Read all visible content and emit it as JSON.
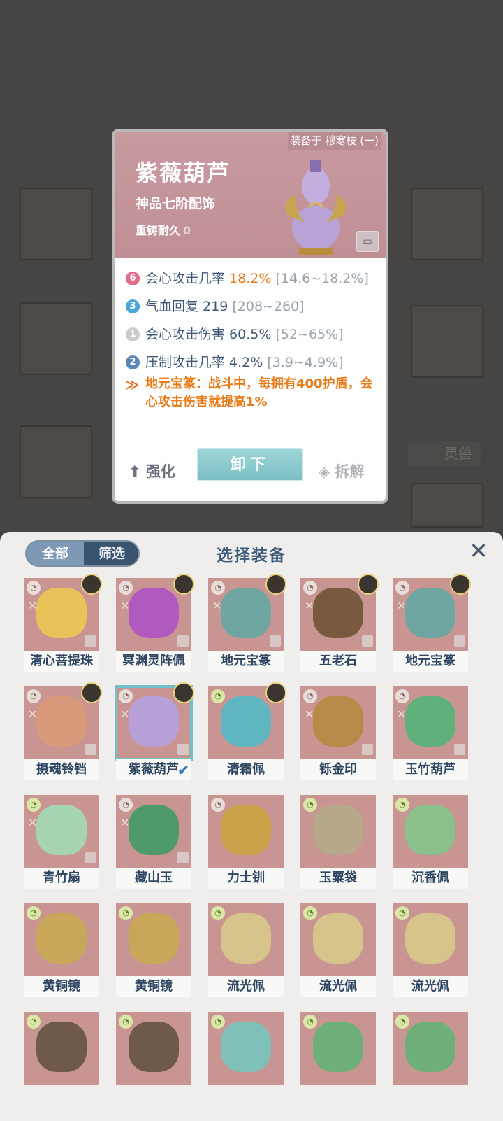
{
  "popup": {
    "equipped_to": "装备于 穆寒枝 (一)",
    "name": "紫薇葫芦",
    "grade": "神品七阶配饰",
    "recast_label": "重铸耐久",
    "recast_value": "0",
    "stats": [
      {
        "badge": "6",
        "badge_color": "#e56a8c",
        "label": "会心攻击几率 ",
        "value": "18.2%",
        "highlight": true,
        "range": " [14.6~18.2%]"
      },
      {
        "badge": "3",
        "badge_color": "#4aa8d6",
        "label": "气血回复 ",
        "value": "219",
        "highlight": false,
        "range": " [208~260]"
      },
      {
        "badge": "1",
        "badge_color": "#c9cbcf",
        "label": "会心攻击伤害 ",
        "value": "60.5%",
        "highlight": false,
        "range": " [52~65%]"
      },
      {
        "badge": "2",
        "badge_color": "#5b86b8",
        "label": "压制攻击几率 ",
        "value": "4.2%",
        "highlight": false,
        "range": " [3.9~4.9%]"
      }
    ],
    "special_text": "地元宝篆：战斗中，每拥有400护盾，会心攻击伤害就提高1%",
    "actions": {
      "strengthen": "强化",
      "unequip": "卸下",
      "dismantle": "拆解"
    }
  },
  "background": {
    "tag": "灵兽"
  },
  "panel": {
    "tab_all": "全部",
    "tab_filter": "筛选",
    "title": "选择装备",
    "close_icon": "close-icon",
    "items": [
      {
        "name": "清心菩提珠",
        "color": "#e8c35a",
        "elem": "grey",
        "avatar": true
      },
      {
        "name": "冥渊灵阵佩",
        "color": "#b05ac0",
        "elem": "grey",
        "avatar": true
      },
      {
        "name": "地元宝篆",
        "color": "#6fa6a2",
        "elem": "grey",
        "avatar": true
      },
      {
        "name": "五老石",
        "color": "#7a5a3e",
        "elem": "grey",
        "avatar": true
      },
      {
        "name": "地元宝篆",
        "color": "#6fa6a2",
        "elem": "grey",
        "avatar": true
      },
      {
        "name": "摄魂铃铛",
        "color": "#d99a7c",
        "elem": "grey",
        "avatar": true
      },
      {
        "name": "紫薇葫芦",
        "color": "#b7a0d8",
        "elem": "grey",
        "avatar": true,
        "selected": true
      },
      {
        "name": "清霜佩",
        "color": "#5fb5c0",
        "elem": "green",
        "avatar": true
      },
      {
        "name": "铄金印",
        "color": "#b88a48",
        "elem": "grey",
        "avatar": false
      },
      {
        "name": "玉竹葫芦",
        "color": "#5fb07a",
        "elem": "grey",
        "avatar": false
      },
      {
        "name": "青竹扇",
        "color": "#a7d4b0",
        "elem": "green",
        "avatar": false
      },
      {
        "name": "藏山玉",
        "color": "#4f9a6a",
        "elem": "grey",
        "avatar": false
      },
      {
        "name": "力士钏",
        "color": "#c9a24a",
        "elem": "grey",
        "avatar": false
      },
      {
        "name": "玉粟袋",
        "color": "#b7a88a",
        "elem": "green",
        "avatar": false
      },
      {
        "name": "沉香佩",
        "color": "#8bc08a",
        "elem": "green",
        "avatar": false
      },
      {
        "name": "黄铜镜",
        "color": "#c9a75a",
        "elem": "green",
        "avatar": false
      },
      {
        "name": "黄铜镜",
        "color": "#c9a75a",
        "elem": "green",
        "avatar": false
      },
      {
        "name": "流光佩",
        "color": "#d6c48a",
        "elem": "green",
        "avatar": false
      },
      {
        "name": "流光佩",
        "color": "#d6c48a",
        "elem": "green",
        "avatar": false
      },
      {
        "name": "流光佩",
        "color": "#d6c48a",
        "elem": "green",
        "avatar": false
      },
      {
        "name": "",
        "color": "#6f5a4a",
        "elem": "green",
        "avatar": false
      },
      {
        "name": "",
        "color": "#6f5a4a",
        "elem": "green",
        "avatar": false
      },
      {
        "name": "",
        "color": "#7fc0b8",
        "elem": "green",
        "avatar": false
      },
      {
        "name": "",
        "color": "#6fb07a",
        "elem": "green",
        "avatar": false
      },
      {
        "name": "",
        "color": "#6fb07a",
        "elem": "green",
        "avatar": false
      }
    ]
  }
}
